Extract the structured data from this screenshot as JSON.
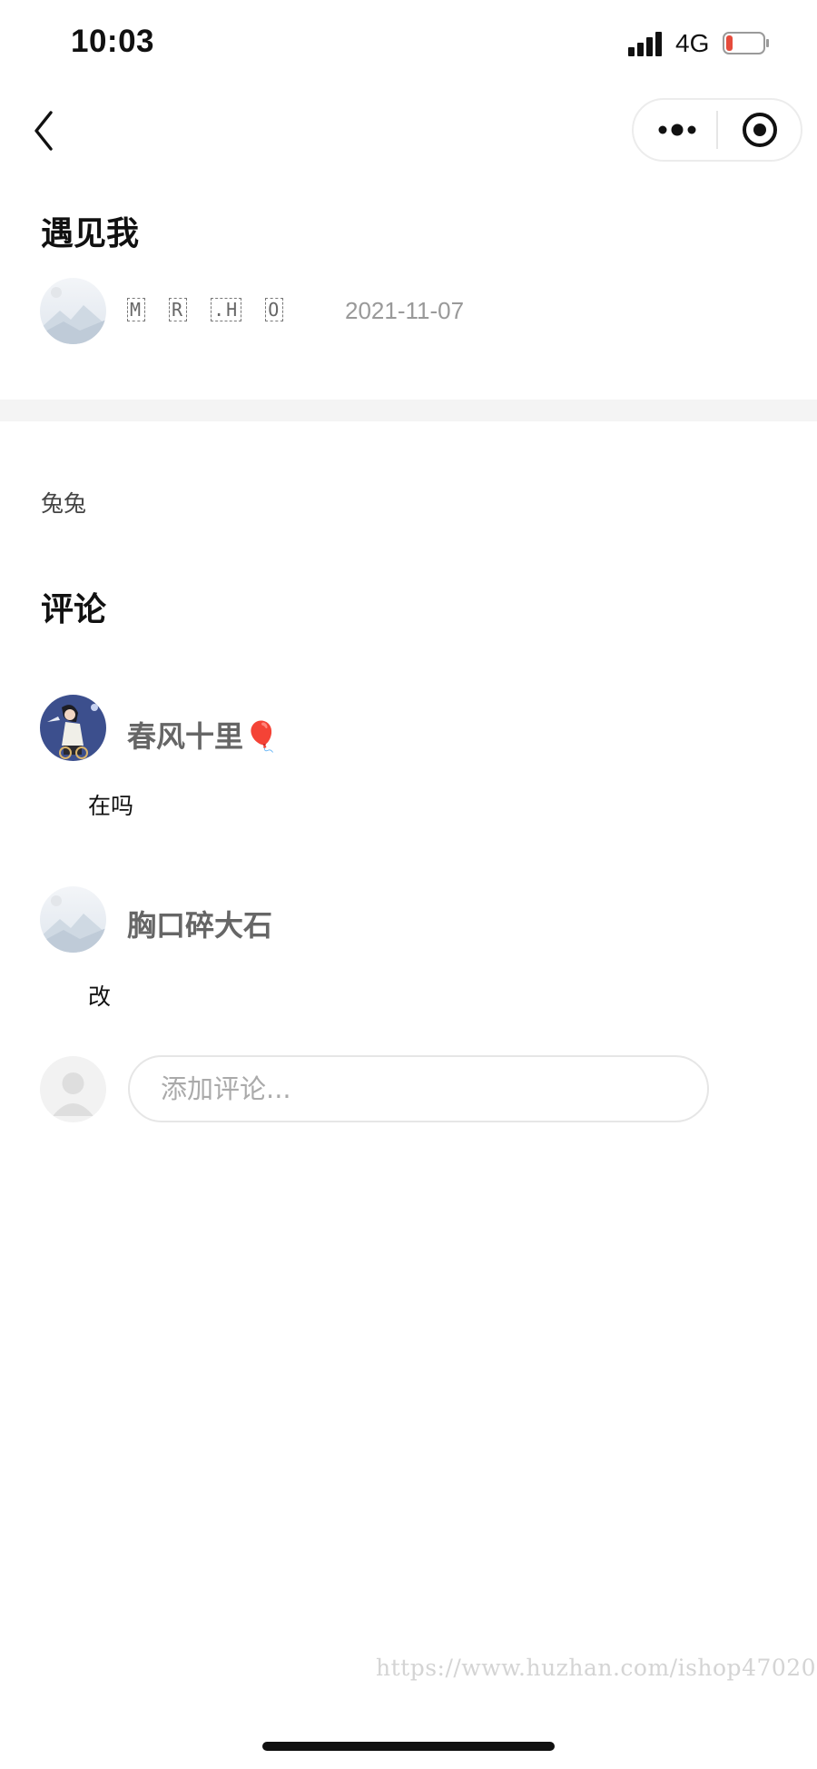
{
  "status_bar": {
    "time": "10:03",
    "network": "4G"
  },
  "nav": {
    "back_icon": "chevron-left-icon",
    "more_icon": "more-dots-icon",
    "close_icon": "target-close-icon"
  },
  "post": {
    "title": "遇见我",
    "author_chars": [
      "M",
      "R",
      ".H",
      "O"
    ],
    "date": "2021-11-07",
    "body": "兔兔"
  },
  "comments": {
    "heading": "评论",
    "items": [
      {
        "name": "春风十里🎈",
        "text": "在吗"
      },
      {
        "name": "胸口碎大石",
        "text": "改"
      }
    ],
    "input_placeholder": "添加评论..."
  },
  "watermark": "https://www.huzhan.com/ishop47020",
  "colors": {
    "divider_band": "#f4f4f4",
    "muted_text": "#999999",
    "battery_low": "#e54b3c"
  }
}
